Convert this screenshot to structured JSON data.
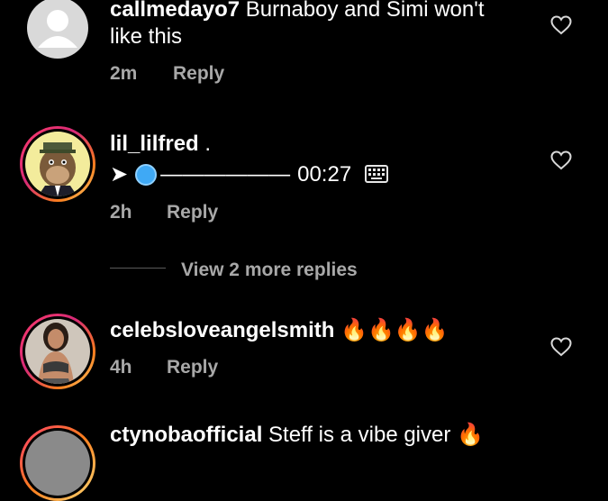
{
  "comments": [
    {
      "username": "callmedayo7",
      "text_line1": "Burnaboy and Simi won't",
      "text_line2": "like this",
      "time": "2m",
      "reply": "Reply"
    },
    {
      "username": "lil_lilfred",
      "suffix": ".",
      "voice_arrow": "➤",
      "voice_dash": "——————",
      "voice_time": "00:27",
      "time": "2h",
      "reply": "Reply"
    },
    {
      "username": "celebsloveangelsmith",
      "emojis": "🔥🔥🔥🔥",
      "time": "4h",
      "reply": "Reply"
    },
    {
      "username": "ctynobaofficial",
      "text": "Steff is a vibe giver",
      "emoji": "🔥"
    }
  ],
  "view_more": "View 2 more replies",
  "icons": {
    "like": "heart-icon",
    "keyboard": "keyboard-icon",
    "voice": "blue-circle-icon"
  },
  "colors": {
    "background": "#000000",
    "meta": "#a8a8a8",
    "voice_dot": "#3fa9f5"
  }
}
